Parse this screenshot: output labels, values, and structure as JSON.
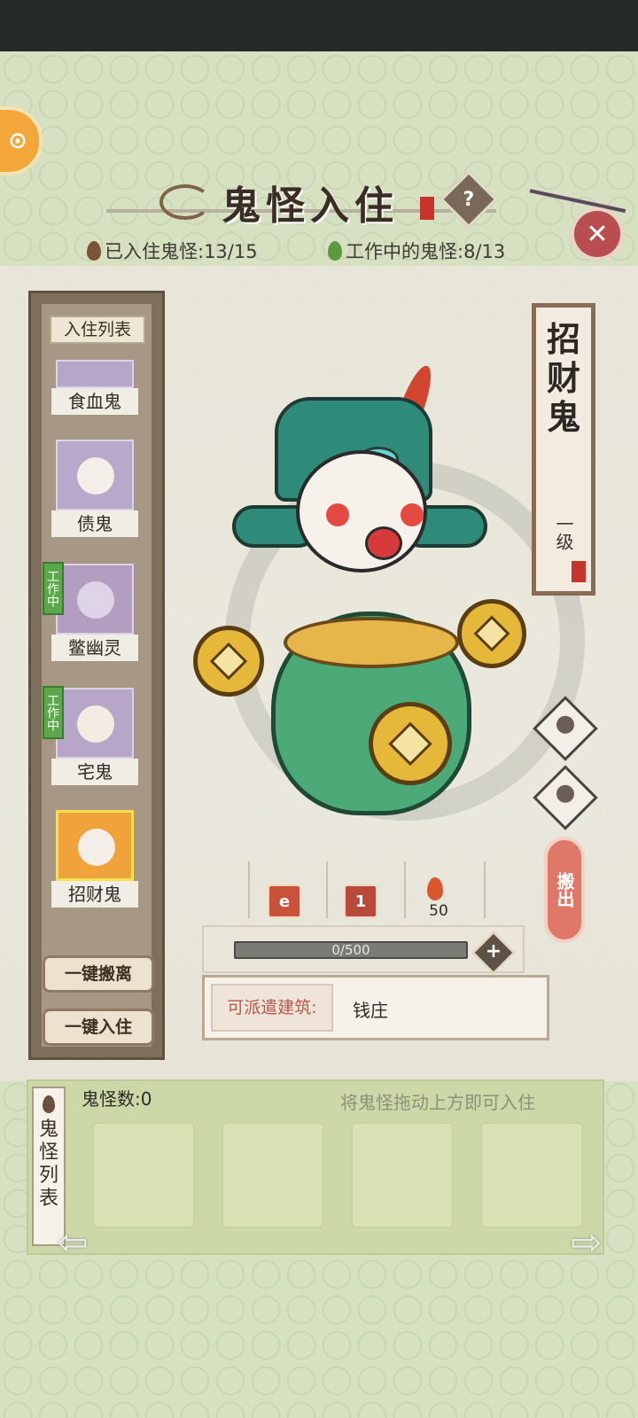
{
  "header": {
    "title": "鬼怪入住",
    "help_icon": "?",
    "close_icon": "✕",
    "resident_count": "已入住鬼怪:13/15",
    "working_count": "工作中的鬼怪:8/13"
  },
  "sidebar": {
    "header": "入住列表",
    "items": [
      {
        "name": "食血鬼",
        "working": false,
        "badge": ""
      },
      {
        "name": "债鬼",
        "working": false,
        "badge": ""
      },
      {
        "name": "鳖幽灵",
        "working": true,
        "badge": "工作中"
      },
      {
        "name": "宅鬼",
        "working": true,
        "badge": "工作中"
      },
      {
        "name": "招财鬼",
        "working": false,
        "badge": "",
        "selected": true
      }
    ],
    "remove_all_label": "一键搬离",
    "move_in_all_label": "一键入住"
  },
  "character": {
    "name": "招财鬼",
    "level": "一级",
    "move_out_label": "搬出",
    "stat_1_icon": "e",
    "stat_2_value": "1",
    "fire_value": "50",
    "exp_text": "0/500",
    "exp_progress": 0,
    "dispatch_label": "可派遣建筑:",
    "dispatch_value": "钱庄"
  },
  "bottom": {
    "tab_label": "鬼怪列表",
    "count_label": "鬼怪数:0",
    "hint": "将鬼怪拖动上方即可入住",
    "slots": 4
  },
  "colors": {
    "background": "#d7e1c2",
    "accent_red": "#c8342c",
    "working_green": "#5aa84a",
    "selected_orange": "#f0a33a"
  }
}
